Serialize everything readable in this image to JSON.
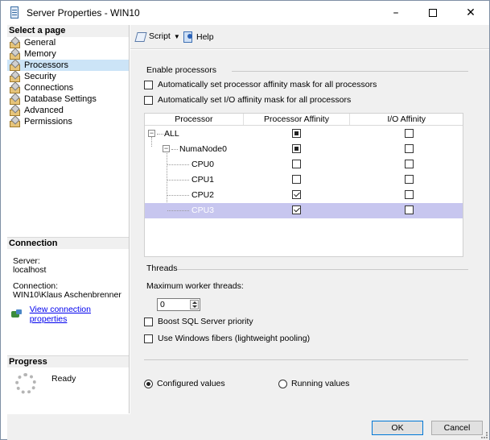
{
  "window": {
    "title": "Server Properties - WIN10",
    "minimize": "–",
    "close": "✕"
  },
  "left": {
    "header": "Select a page",
    "pages": [
      {
        "label": "General",
        "selected": false
      },
      {
        "label": "Memory",
        "selected": false
      },
      {
        "label": "Processors",
        "selected": true
      },
      {
        "label": "Security",
        "selected": false
      },
      {
        "label": "Connections",
        "selected": false
      },
      {
        "label": "Database Settings",
        "selected": false
      },
      {
        "label": "Advanced",
        "selected": false
      },
      {
        "label": "Permissions",
        "selected": false
      }
    ],
    "connection": {
      "header": "Connection",
      "server_label": "Server:",
      "server_value": "localhost",
      "connection_label": "Connection:",
      "connection_value": "WIN10\\Klaus Aschenbrenner",
      "view_link": "View connection properties"
    },
    "progress": {
      "header": "Progress",
      "status": "Ready"
    }
  },
  "toolbar": {
    "script_label": "Script",
    "help_label": "Help"
  },
  "processors": {
    "enable_group": "Enable processors",
    "auto_affinity_label": "Automatically set processor affinity mask for all processors",
    "auto_affinity_checked": false,
    "auto_io_label": "Automatically set I/O affinity mask for all processors",
    "auto_io_checked": false,
    "columns": [
      "Processor",
      "Processor Affinity",
      "I/O Affinity"
    ],
    "rows": [
      {
        "label": "ALL",
        "level": 0,
        "affinity": "partial",
        "io": "unchecked",
        "selected": false
      },
      {
        "label": "NumaNode0",
        "level": 1,
        "affinity": "partial",
        "io": "unchecked",
        "selected": false
      },
      {
        "label": "CPU0",
        "level": 2,
        "affinity": "unchecked",
        "io": "unchecked",
        "selected": false
      },
      {
        "label": "CPU1",
        "level": 2,
        "affinity": "unchecked",
        "io": "unchecked",
        "selected": false
      },
      {
        "label": "CPU2",
        "level": 2,
        "affinity": "checked",
        "io": "unchecked",
        "selected": false
      },
      {
        "label": "CPU3",
        "level": 2,
        "affinity": "checked",
        "io": "unchecked",
        "selected": true
      }
    ],
    "threads_group": "Threads",
    "max_worker_label": "Maximum worker threads:",
    "max_worker_value": "0",
    "boost_label": "Boost SQL Server priority",
    "boost_checked": false,
    "fibers_label": "Use Windows fibers (lightweight pooling)",
    "fibers_checked": false,
    "configured_label": "Configured  values",
    "configured_selected": true,
    "running_label": "Running values",
    "running_selected": false
  },
  "buttons": {
    "ok": "OK",
    "cancel": "Cancel"
  }
}
